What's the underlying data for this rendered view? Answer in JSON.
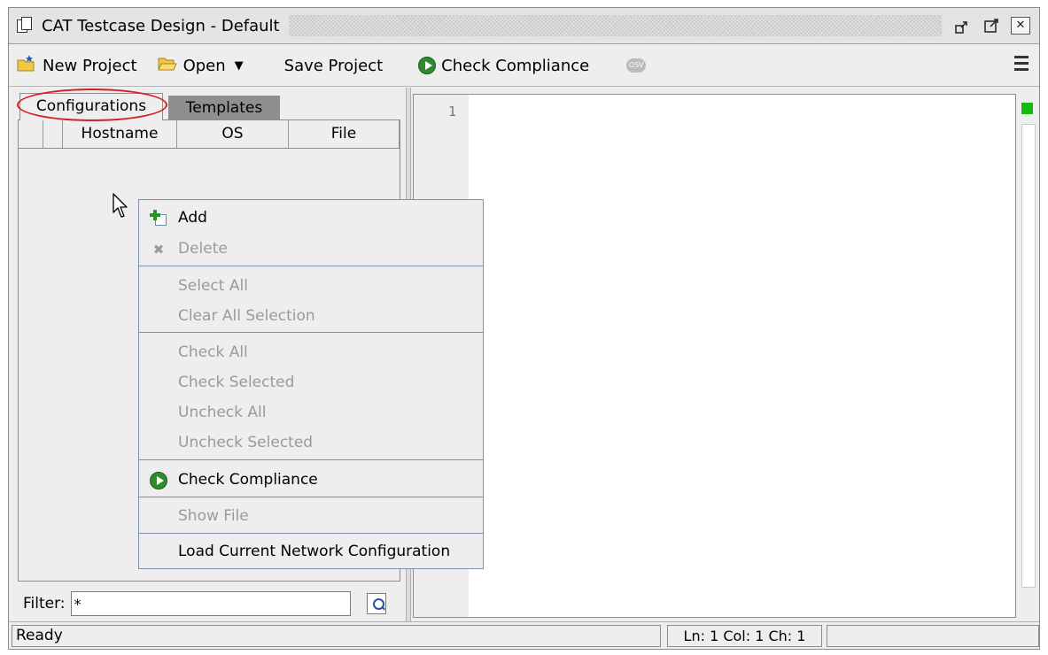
{
  "window": {
    "title": "CAT Testcase Design - Default"
  },
  "toolbar": {
    "new_project": "New Project",
    "open": "Open",
    "save_project": "Save Project",
    "check_compliance": "Check Compliance",
    "osv_icon_text": "OSV"
  },
  "tabs": [
    {
      "label": "Configurations",
      "active": true
    },
    {
      "label": "Templates",
      "active": false
    }
  ],
  "table": {
    "columns": [
      "",
      "",
      "Hostname",
      "OS",
      "File"
    ]
  },
  "filter": {
    "label": "Filter:",
    "value": "*"
  },
  "editor": {
    "line_numbers": [
      "1"
    ]
  },
  "context_menu": {
    "items": [
      {
        "label": "Add",
        "enabled": true,
        "icon": "add-icon"
      },
      {
        "label": "Delete",
        "enabled": false,
        "icon": "delete-icon"
      },
      {
        "label": "Select All",
        "enabled": false
      },
      {
        "label": "Clear All Selection",
        "enabled": false
      },
      {
        "label": "Check All",
        "enabled": false
      },
      {
        "label": "Check Selected",
        "enabled": false
      },
      {
        "label": "Uncheck All",
        "enabled": false
      },
      {
        "label": "Uncheck Selected",
        "enabled": false
      },
      {
        "label": "Check Compliance",
        "enabled": true,
        "icon": "play-icon"
      },
      {
        "label": "Show File",
        "enabled": false
      },
      {
        "label": "Load Current Network Configuration",
        "enabled": true
      }
    ]
  },
  "status": {
    "text": "Ready",
    "position": "Ln: 1 Col: 1 Ch: 1"
  },
  "colors": {
    "highlight_ring": "#d62020",
    "play_green": "#2e8b2e",
    "marker_green": "#11bb11",
    "disabled_text": "#9a9a9a"
  }
}
